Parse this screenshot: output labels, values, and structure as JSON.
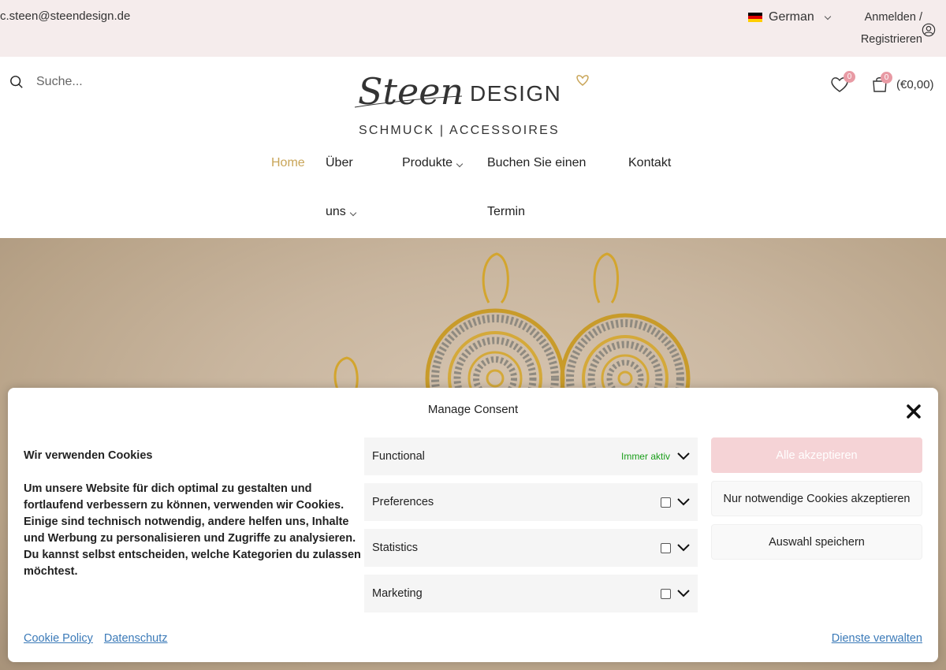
{
  "topbar": {
    "email": "c.steen@steendesign.de",
    "language": "German",
    "login_line1": "Anmelden /",
    "login_line2": "Registrieren"
  },
  "header": {
    "search_placeholder": "Suche...",
    "logo_script": "Steen",
    "logo_word": "DESIGN",
    "logo_tagline": "SCHMUCK | ACCESSOIRES",
    "wishlist_count": "0",
    "cart_count": "0",
    "cart_total": "(€0,00)"
  },
  "nav": {
    "home": "Home",
    "about_1": "Über",
    "about_2": "uns",
    "products": "Produkte",
    "booking_1": "Buchen Sie einen",
    "booking_2": "Termin",
    "contact": "Kontakt"
  },
  "consent": {
    "title": "Manage Consent",
    "heading": "Wir verwenden Cookies",
    "text": "Um unsere Website für dich optimal zu gestalten und fortlaufend verbessern zu können, verwenden wir Cookies. Einige sind technisch notwendig, andere helfen uns, Inhalte und Werbung zu personalisieren und Zugriffe zu analysieren. Du kannst selbst entscheiden, welche Kategorien du zulassen möchtest.",
    "categories": [
      {
        "name": "Functional",
        "status": "Immer aktiv"
      },
      {
        "name": "Preferences"
      },
      {
        "name": "Statistics"
      },
      {
        "name": "Marketing"
      }
    ],
    "accept_all": "Alle akzeptieren",
    "accept_necessary": "Nur notwendige Cookies akzeptieren",
    "save_selection": "Auswahl speichern",
    "cookie_policy": "Cookie Policy",
    "privacy": "Datenschutz",
    "manage_services": "Dienste verwalten"
  },
  "colors": {
    "topbar_bg": "#f5ecec",
    "accent_gold": "#c9a558",
    "badge_pink": "#e89aa4",
    "accept_pink": "#f5d3d6",
    "active_green": "#1a9e1a",
    "link_blue": "#3b7ab8"
  }
}
